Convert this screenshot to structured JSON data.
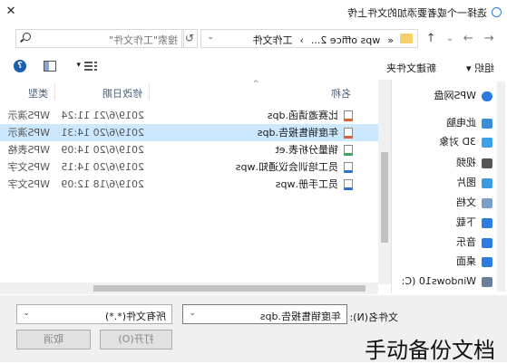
{
  "window": {
    "title": "选择一个或者要添加的文件上传",
    "close": "✕"
  },
  "nav": {
    "back": "←",
    "forward": "→",
    "recent": "⌄",
    "up": "↑"
  },
  "address": {
    "prefix": "«",
    "parts": [
      "wps office 2...",
      "工作文件"
    ],
    "separator": "›",
    "dropdown": "⌄",
    "refresh": "↻"
  },
  "search": {
    "placeholder": "搜索\"工作文件\""
  },
  "toolbar": {
    "organize": "组织 ▾",
    "new_folder": "新建文件夹",
    "view_dropdown": "▾",
    "help": "?"
  },
  "sidebar": {
    "items": [
      {
        "label": "WPS网盘",
        "icon": "cloud-icon",
        "color": "#2b7be0"
      },
      {
        "label": "此电脑",
        "icon": "computer-icon",
        "color": "#3a8fd8"
      },
      {
        "label": "3D 对象",
        "icon": "cube-icon",
        "color": "#3aa0e8"
      },
      {
        "label": "视频",
        "icon": "video-icon",
        "color": "#555555"
      },
      {
        "label": "图片",
        "icon": "picture-icon",
        "color": "#3c9be0"
      },
      {
        "label": "文档",
        "icon": "document-icon",
        "color": "#7aa0c8"
      },
      {
        "label": "下载",
        "icon": "download-icon",
        "color": "#2b7be0"
      },
      {
        "label": "音乐",
        "icon": "music-icon",
        "color": "#2b7be0"
      },
      {
        "label": "桌面",
        "icon": "desktop-icon",
        "color": "#2b7be0"
      },
      {
        "label": "Windows10 (C:",
        "icon": "drive-icon",
        "color": "#6a7f99"
      }
    ]
  },
  "columns": {
    "name": "名称",
    "date": "修改日期",
    "type": "类型",
    "sort": "^"
  },
  "files": [
    {
      "name": "比赛邀请函.dps",
      "date": "2019/6/21 11:24",
      "type": "WPS演示",
      "accent": "#e0603a"
    },
    {
      "name": "年度销售报告.dps",
      "date": "2019/6/20 14:31",
      "type": "WPS演示",
      "accent": "#e0603a",
      "selected": true
    },
    {
      "name": "销量分析表.et",
      "date": "2019/6/20 14:09",
      "type": "WPS表格",
      "accent": "#3aa05a"
    },
    {
      "name": "员工培训会议通知.wps",
      "date": "2019/6/20 14:15",
      "type": "WPS文字",
      "accent": "#2b6fd8"
    },
    {
      "name": "员工手册.wps",
      "date": "2019/6/18 12:09",
      "type": "WPS文字",
      "accent": "#2b6fd8"
    }
  ],
  "footer": {
    "filename_label": "文件名(N):",
    "filename_value": "年度销售报告.dps",
    "filter": "所有文件(*.*)",
    "open": "打开(O)",
    "cancel": "取消"
  },
  "watermark": "手动备份文档"
}
